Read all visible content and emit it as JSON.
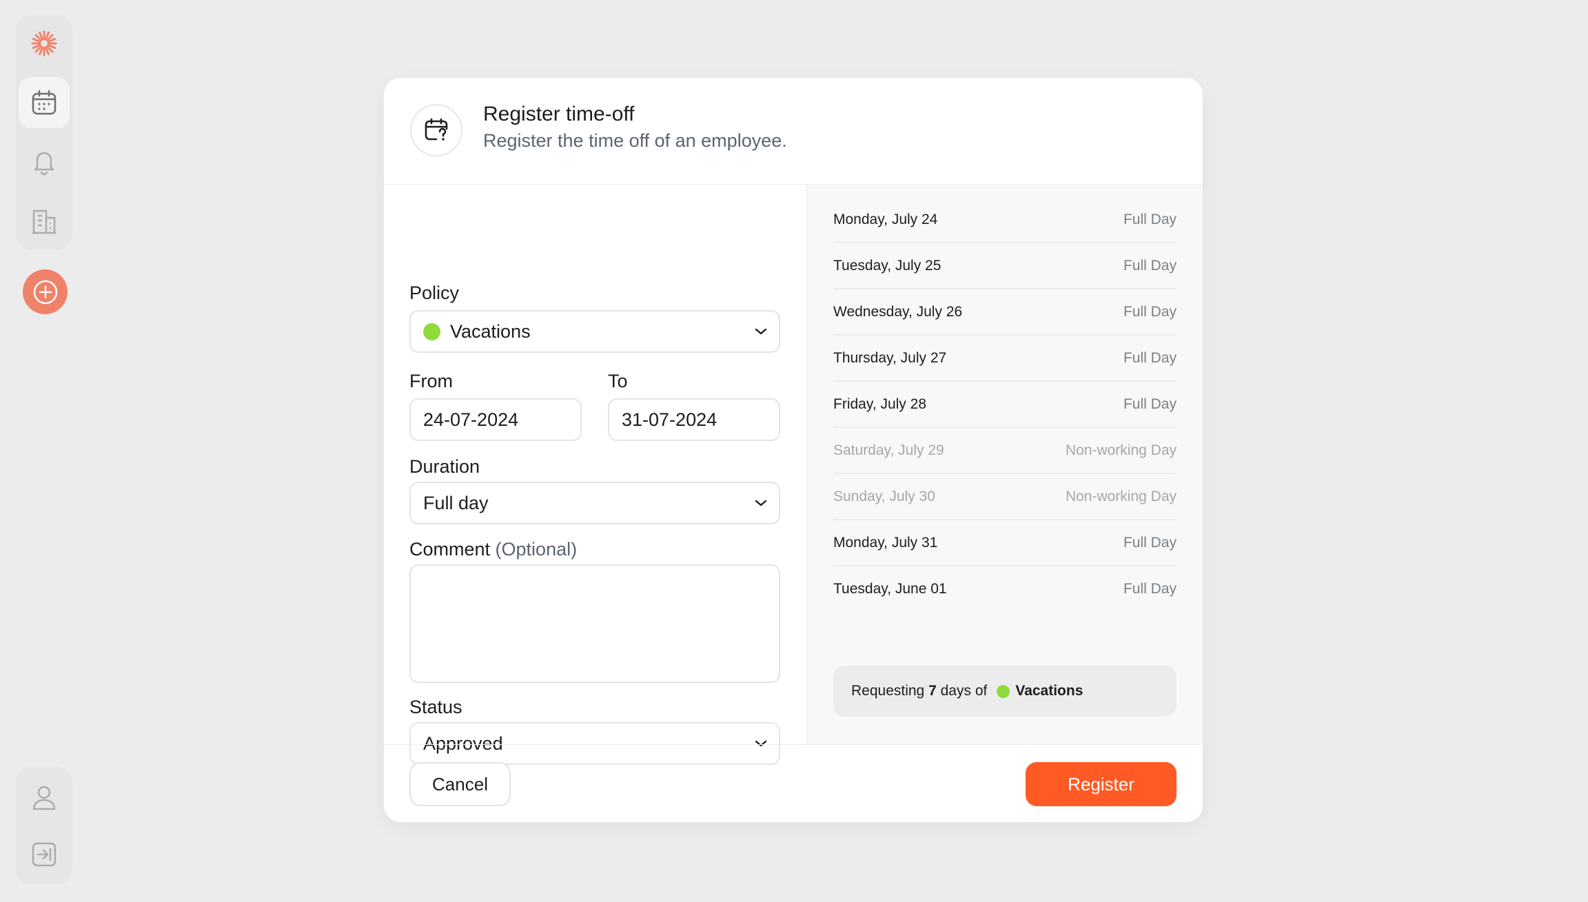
{
  "sidebar": {
    "logo": "sunburst-logo",
    "items": [
      {
        "icon": "calendar-icon",
        "active": true
      },
      {
        "icon": "bell-icon",
        "active": false
      },
      {
        "icon": "building-icon",
        "active": false
      }
    ],
    "add_icon": "plus-circle-icon",
    "bottom_items": [
      {
        "icon": "user-icon"
      },
      {
        "icon": "logout-icon"
      }
    ],
    "accent": "#f0826a"
  },
  "modal": {
    "title": "Register time-off",
    "subtitle": "Register the time off of an employee.",
    "icon": "calendar-clock-icon"
  },
  "form": {
    "policy": {
      "label": "Policy",
      "value": "Vacations",
      "color": "#8fdb3b"
    },
    "from": {
      "label": "From",
      "value": "24-07-2024"
    },
    "to": {
      "label": "To",
      "value": "31-07-2024"
    },
    "duration": {
      "label": "Duration",
      "value": "Full day"
    },
    "comment": {
      "label": "Comment",
      "optional": "(Optional)",
      "value": ""
    },
    "status": {
      "label": "Status",
      "value": "Approved"
    }
  },
  "days": [
    {
      "date": "Monday, July 24",
      "type": "Full Day",
      "working": true
    },
    {
      "date": "Tuesday, July 25",
      "type": "Full Day",
      "working": true
    },
    {
      "date": "Wednesday, July 26",
      "type": "Full Day",
      "working": true
    },
    {
      "date": "Thursday, July 27",
      "type": "Full Day",
      "working": true
    },
    {
      "date": "Friday, July 28",
      "type": "Full Day",
      "working": true
    },
    {
      "date": "Saturday, July 29",
      "type": "Non-working Day",
      "working": false
    },
    {
      "date": "Sunday, July 30",
      "type": "Non-working Day",
      "working": false
    },
    {
      "date": "Monday, July 31",
      "type": "Full Day",
      "working": true
    },
    {
      "date": "Tuesday, June 01",
      "type": "Full Day",
      "working": true
    }
  ],
  "summary": {
    "prefix": "Requesting",
    "count": "7",
    "middle": "days of",
    "policy": "Vacations"
  },
  "footer": {
    "cancel_label": "Cancel",
    "register_label": "Register",
    "register_color": "#ff5a24"
  }
}
